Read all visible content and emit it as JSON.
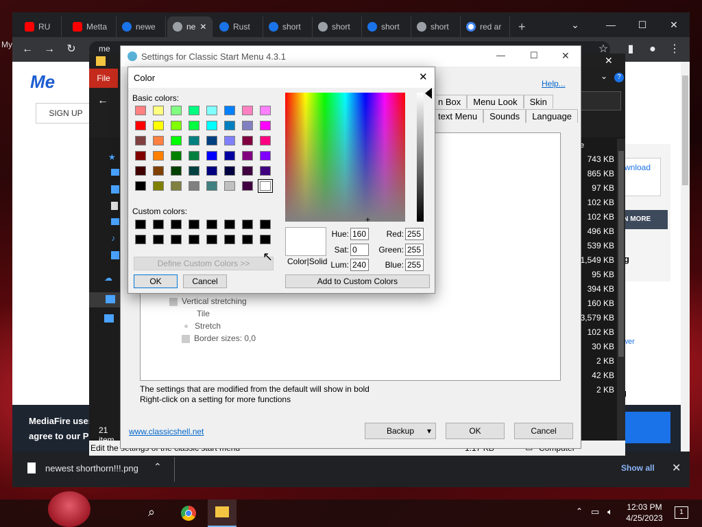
{
  "browser": {
    "tabs": [
      {
        "label": "RU",
        "icon": "youtube-icon",
        "color": "#ff0000"
      },
      {
        "label": "Metta",
        "icon": "youtube-icon",
        "color": "#ff0000"
      },
      {
        "label": "newe",
        "icon": "mediafire-icon",
        "color": "#1a73e8"
      },
      {
        "label": "ne",
        "icon": "globe-icon",
        "color": "#9aa0a6",
        "active": true
      },
      {
        "label": "Rust",
        "icon": "mediafire-icon",
        "color": "#1a73e8"
      },
      {
        "label": "short",
        "icon": "mediafire-icon",
        "color": "#1a73e8"
      },
      {
        "label": "short",
        "icon": "globe-icon",
        "color": "#9aa0a6"
      },
      {
        "label": "short",
        "icon": "mediafire-icon",
        "color": "#1a73e8"
      },
      {
        "label": "short",
        "icon": "globe-icon",
        "color": "#9aa0a6"
      },
      {
        "label": "red ar",
        "icon": "google-icon",
        "color": "#4285f4"
      }
    ],
    "new_tab": "+",
    "address_partial": "me",
    "page": {
      "logo": "Me",
      "signup": "SIGN UP",
      "banner_text_1": "MediaFire uses",
      "banner_text_2": "agree to our Pr",
      "download_btn": "wnload",
      "learn_more": "RN MORE",
      "side_heading_1": "ng",
      "side_link": "ewer",
      "side_heading_2": "ng",
      "accept": "pt",
      "my_label": "My"
    },
    "download_bar": {
      "filename": "newest shorthorn!!!.png",
      "show_all": "Show all"
    }
  },
  "explorer": {
    "file_tab": "File",
    "items_count": "21 item",
    "status": "Edit the settings of the classic start menu",
    "status_size": "1.17 KB",
    "status_location": "Computer",
    "sizes": [
      "743 KB",
      "865 KB",
      "97 KB",
      "102 KB",
      "102 KB",
      "496 KB",
      "539 KB",
      "1,549 KB",
      "95 KB",
      "394 KB",
      "160 KB",
      "3,579 KB",
      "102 KB",
      "30 KB",
      "2 KB",
      "42 KB",
      "2 KB"
    ],
    "col_header": "e"
  },
  "settings": {
    "title": "Settings for Classic Start Menu 4.3.1",
    "help": "Help...",
    "tabs_row1": [
      "n Box",
      "Menu Look",
      "Skin"
    ],
    "tabs_row2": [
      "text Menu",
      "Sounds",
      "Language"
    ],
    "tree": [
      {
        "label": "Vertical stretching",
        "level": 0
      },
      {
        "label": "Tile",
        "level": 1
      },
      {
        "label": "Stretch",
        "level": 1
      },
      {
        "label": "Border sizes: 0,0",
        "level": 0
      }
    ],
    "info_1": "The settings that are modified from the default will show in bold",
    "info_2": "Right-click on a setting for more functions",
    "link": "www.classicshell.net",
    "backup": "Backup",
    "ok": "OK",
    "cancel": "Cancel"
  },
  "color_dialog": {
    "title": "Color",
    "basic_label": "Basic colors:",
    "basic_colors": [
      "#ff8080",
      "#ffff80",
      "#80ff80",
      "#00ff80",
      "#80ffff",
      "#0080ff",
      "#ff80c0",
      "#ff80ff",
      "#ff0000",
      "#ffff00",
      "#80ff00",
      "#00ff40",
      "#00ffff",
      "#0080c0",
      "#8080c0",
      "#ff00ff",
      "#804040",
      "#ff8040",
      "#00ff00",
      "#008080",
      "#004080",
      "#8080ff",
      "#800040",
      "#ff0080",
      "#800000",
      "#ff8000",
      "#008000",
      "#008040",
      "#0000ff",
      "#0000a0",
      "#800080",
      "#8000ff",
      "#400000",
      "#804000",
      "#004000",
      "#004040",
      "#000080",
      "#000040",
      "#400040",
      "#400080",
      "#000000",
      "#808000",
      "#808040",
      "#808080",
      "#408080",
      "#c0c0c0",
      "#400040",
      "#ffffff"
    ],
    "selected_index": 47,
    "custom_label": "Custom colors:",
    "custom_colors": [
      "#000000",
      "#000000",
      "#000000",
      "#000000",
      "#000000",
      "#000000",
      "#000000",
      "#000000",
      "#000000",
      "#000000",
      "#000000",
      "#000000",
      "#000000",
      "#000000",
      "#000000",
      "#000000"
    ],
    "define_custom": "Define Custom Colors >>",
    "ok": "OK",
    "cancel": "Cancel",
    "color_solid": "Color|Solid",
    "hue_label": "Hue:",
    "hue": "160",
    "sat_label": "Sat:",
    "sat": "0",
    "lum_label": "Lum:",
    "lum": "240",
    "red_label": "Red:",
    "red": "255",
    "green_label": "Green:",
    "green": "255",
    "blue_label": "Blue:",
    "blue": "255",
    "add_custom": "Add to Custom Colors"
  },
  "taskbar": {
    "time": "12:03 PM",
    "date": "4/25/2023",
    "notification_count": "1"
  }
}
